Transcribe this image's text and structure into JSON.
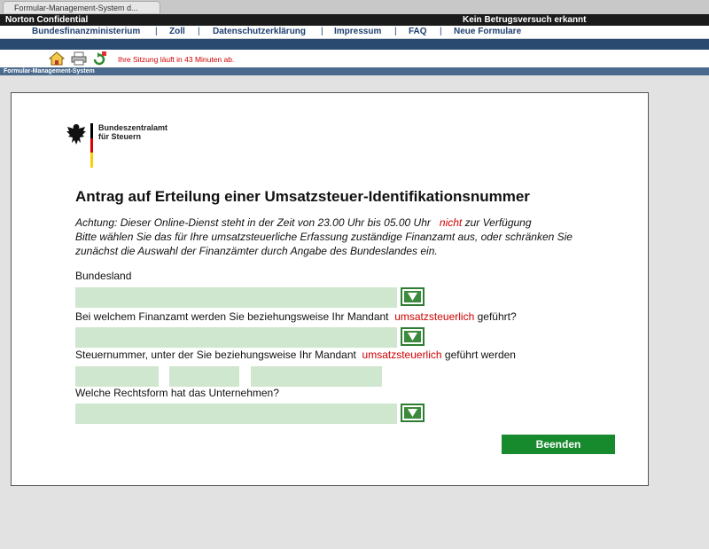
{
  "browser": {
    "tab_title": "Formular-Management-System d..."
  },
  "norton": {
    "left": "Norton Confidential",
    "right": "Kein Betrugsversuch erkannt"
  },
  "nav": {
    "items": [
      "Bundesfinanzministerium",
      "Zoll",
      "Datenschutzerklärung",
      "Impressum",
      "FAQ",
      "Neue Formulare"
    ],
    "separator": "|"
  },
  "toolbar": {
    "session_text": "Ihre Sitzung läuft in 43 Minuten ab.",
    "icons": [
      "home-icon",
      "print-icon",
      "refresh-icon"
    ]
  },
  "system_bar": {
    "label": "Formular-Management-System"
  },
  "agency": {
    "line1": "Bundeszentralamt",
    "line2": "für Steuern"
  },
  "form": {
    "title": "Antrag auf Erteilung einer Umsatzsteuer-Identifikationsnummer",
    "notice_part1": "Achtung: Dieser Online-Dienst steht in der Zeit von 23.00 Uhr bis 05.00 Uhr",
    "notice_highlight": "nicht",
    "notice_part2": "zur Verfügung",
    "notice_line2": "Bitte wählen Sie das für Ihre umsatzsteuerliche Erfassung zuständige Finanzamt aus, oder schränken Sie",
    "notice_line3": "zunächst die Auswahl der Finanzämter durch Angabe des Bundeslandes ein.",
    "bundesland_label": "Bundesland",
    "finanzamt_label_a": "Bei welchem Finanzamt werden Sie beziehungsweise Ihr Mandant",
    "finanzamt_label_highlight": "umsatzsteuerlich",
    "finanzamt_label_b": "geführt?",
    "steuernummer_label_a": "Steuernummer, unter der Sie beziehungsweise Ihr Mandant",
    "steuernummer_label_highlight": "umsatzsteuerlich",
    "steuernummer_label_b": "geführt werden",
    "rechtsform_label": "Welche Rechtsform hat das Unternehmen?",
    "bundesland_value": "",
    "finanzamt_value": "",
    "steuernummer_values": [
      "",
      "",
      ""
    ],
    "rechtsform_value": "",
    "submit_label": "Beenden"
  },
  "colors": {
    "accent_red": "#d00000",
    "field_green": "#cfe6cf",
    "button_green": "#188a2e",
    "nav_blue": "#2b4a70"
  }
}
